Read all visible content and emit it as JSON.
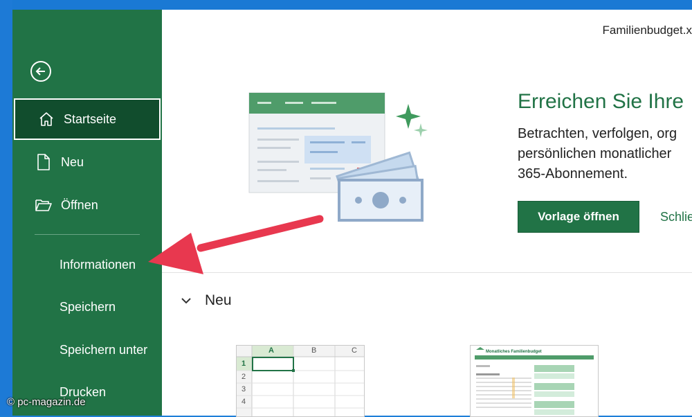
{
  "document": {
    "title": "Familienbudget.x"
  },
  "sidebar": {
    "items": [
      {
        "label": "Startseite",
        "icon": "home-icon",
        "active": true
      },
      {
        "label": "Neu",
        "icon": "new-file-icon"
      },
      {
        "label": "Öffnen",
        "icon": "folder-open-icon"
      },
      {
        "label": "Informationen"
      },
      {
        "label": "Speichern"
      },
      {
        "label": "Speichern unter"
      },
      {
        "label": "Drucken"
      }
    ]
  },
  "hero": {
    "heading": "Erreichen Sie Ihre",
    "description_lines": [
      "Betrachten, verfolgen, org",
      "persönlichen monatlicher",
      "365-Abonnement."
    ],
    "primary_button": "Vorlage öffnen",
    "secondary_link": "Schlie"
  },
  "new_section": {
    "title": "Neu",
    "blank_workbook": {
      "columns": [
        "A",
        "B",
        "C"
      ],
      "rows": [
        "1",
        "2",
        "3",
        "4"
      ]
    },
    "budget_template": {
      "title": "Monatliches Familienbudget"
    }
  },
  "watermark": "© pc-magazin.de",
  "colors": {
    "excel_green": "#217346",
    "dark_green": "#114d2d",
    "arrow_red": "#e8384f"
  }
}
